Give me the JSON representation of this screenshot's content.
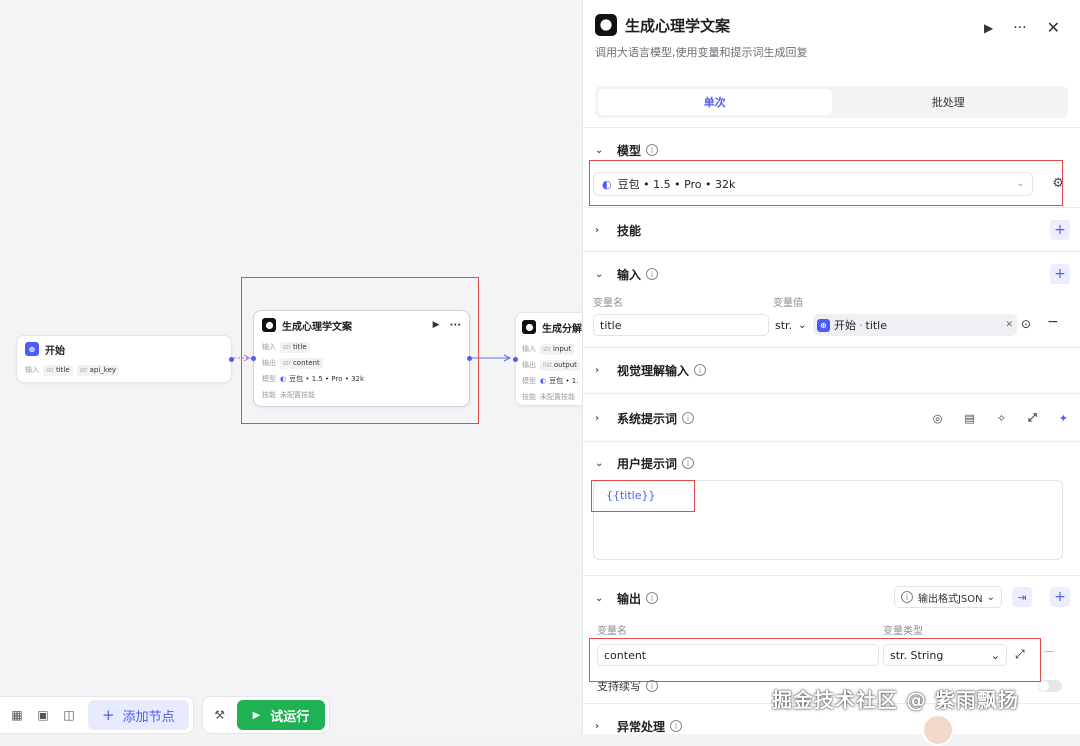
{
  "canvas": {
    "start_node": {
      "title": "开始",
      "in_label": "输入",
      "params": [
        {
          "type": "str",
          "name": "title"
        },
        {
          "type": "str",
          "name": "api_key"
        }
      ]
    },
    "llm_node": {
      "title": "生成心理学文案",
      "rows": [
        {
          "label": "输入",
          "type": "str",
          "value": "title"
        },
        {
          "label": "输出",
          "type": "str",
          "value": "content"
        },
        {
          "label": "模型",
          "value": "豆包 • 1.5 • Pro • 32k"
        },
        {
          "label": "技能",
          "value": "未配置技能"
        }
      ]
    },
    "next_node": {
      "title": "生成分解",
      "rows": [
        {
          "label": "输入",
          "type": "str",
          "value": "input"
        },
        {
          "label": "输出",
          "type": "list",
          "value": "output"
        },
        {
          "label": "模型",
          "value": "豆包 • 1."
        },
        {
          "label": "技能",
          "value": "未配置技能"
        }
      ]
    },
    "bottom": {
      "add_node": "添加节点",
      "run": "试运行"
    }
  },
  "panel": {
    "title": "生成心理学文案",
    "description": "调用大语言模型,使用变量和提示词生成回复",
    "tabs": [
      "单次",
      "批处理"
    ],
    "model": {
      "label": "模型",
      "value": "豆包 • 1.5 • Pro • 32k"
    },
    "skills": {
      "label": "技能"
    },
    "input": {
      "label": "输入",
      "col_name": "变量名",
      "col_value": "变量值",
      "var_name": "title",
      "var_type": "str.",
      "ref_node": "开始",
      "ref_var": "title"
    },
    "vision": {
      "label": "视觉理解输入"
    },
    "system_prompt": {
      "label": "系统提示词"
    },
    "user_prompt": {
      "label": "用户提示词",
      "value": "{{title}}"
    },
    "output": {
      "label": "输出",
      "format": "输出格式JSON",
      "col_name": "变量名",
      "col_type": "变量类型",
      "var_name": "content",
      "var_type": "str. String",
      "stream_label": "支持续写"
    },
    "exception": {
      "label": "异常处理"
    }
  },
  "watermark": "掘金技术社区 @ 紫雨飘扬"
}
